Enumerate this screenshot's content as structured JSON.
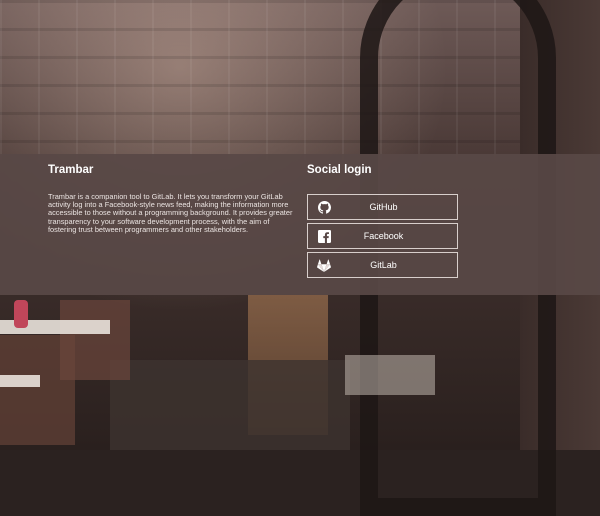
{
  "about": {
    "title": "Trambar",
    "description": "Trambar is a companion tool to GitLab. It lets you transform your GitLab activity log into a Facebook-style news feed, making the information more accessible to those without a programming background. It provides greater transparency to your software development process, with the aim of fostering trust between programmers and other stakeholders."
  },
  "social": {
    "title": "Social login",
    "providers": [
      {
        "label": "GitHub",
        "icon": "github-icon"
      },
      {
        "label": "Facebook",
        "icon": "facebook-icon"
      },
      {
        "label": "GitLab",
        "icon": "gitlab-icon"
      }
    ]
  }
}
